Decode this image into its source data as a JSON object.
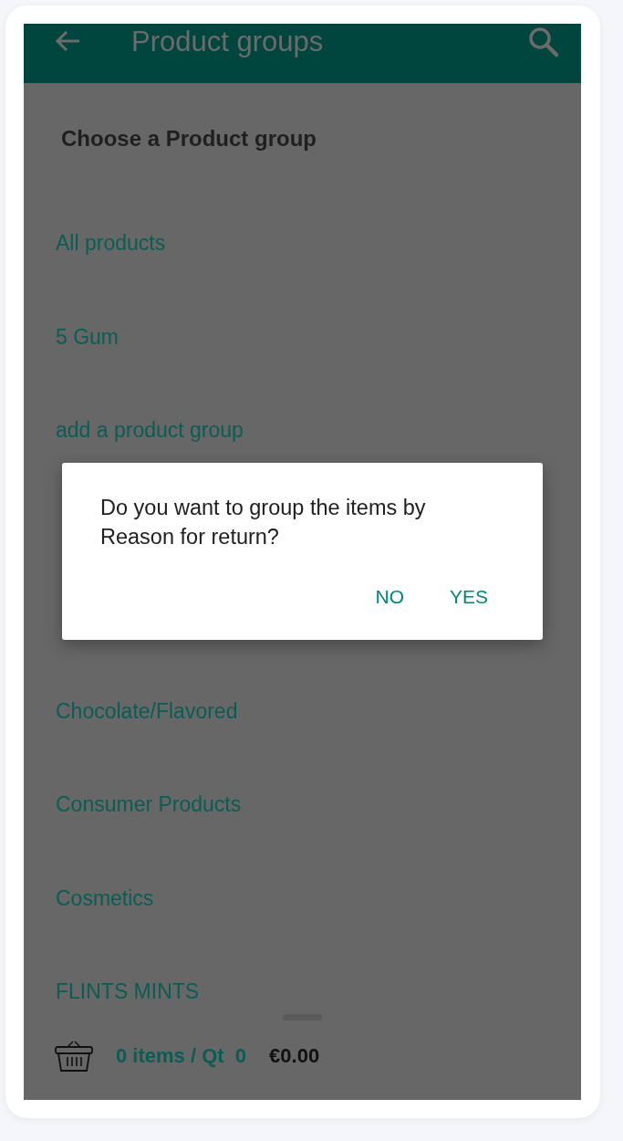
{
  "header": {
    "title": "Product groups"
  },
  "heading": "Choose a Product group",
  "groups_above_dialog": [
    {
      "label": "All products"
    },
    {
      "label": "5 Gum"
    },
    {
      "label": "add a product group"
    }
  ],
  "groups_below_dialog": [
    {
      "label": "Chocolate/Flavored"
    },
    {
      "label": "Consumer Products"
    },
    {
      "label": "Cosmetics"
    },
    {
      "label": "FLINTS MINTS"
    }
  ],
  "dialog": {
    "message": "Do you want to group the items by Reason for return?",
    "buttons": [
      "NO",
      "YES"
    ]
  },
  "cart": {
    "summary": "0 items / Qt  0",
    "total": "€0.00"
  }
}
